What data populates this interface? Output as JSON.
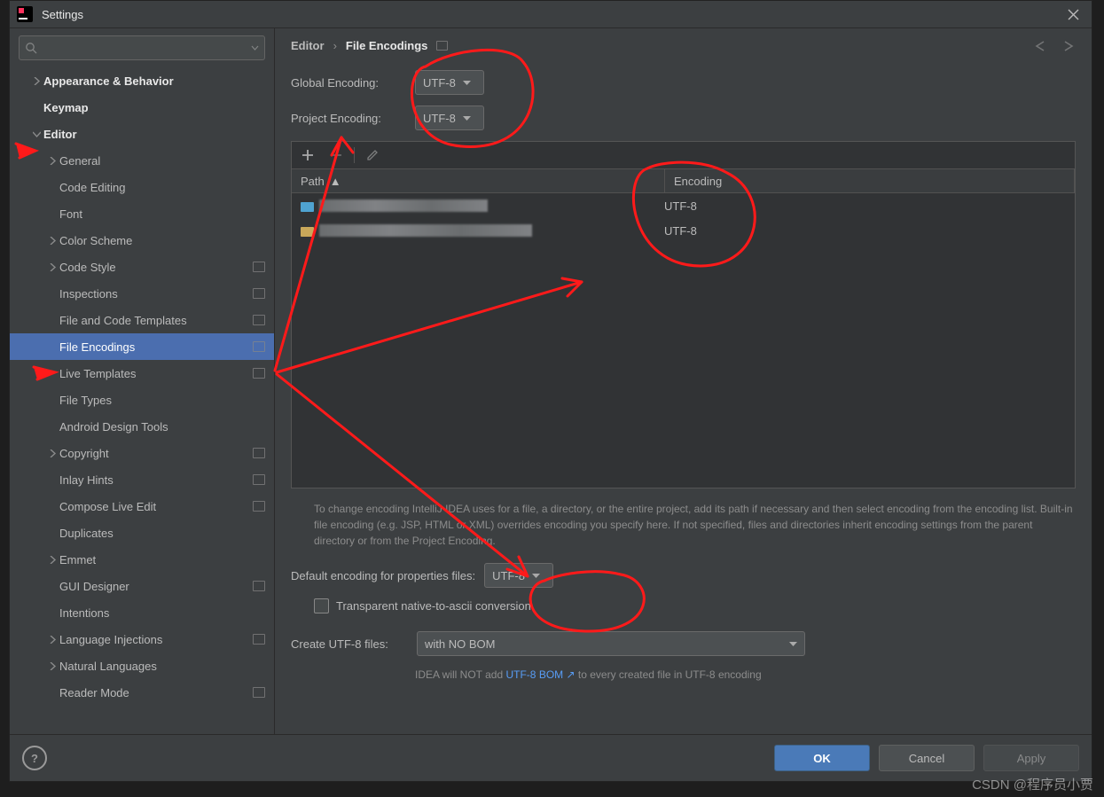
{
  "title": "Settings",
  "search_placeholder": "",
  "breadcrumb": {
    "root": "Editor",
    "current": "File Encodings"
  },
  "sidebarTitle": "Settings",
  "tree": [
    {
      "label": "Appearance & Behavior",
      "indent": 0,
      "chev": "right",
      "bold": true
    },
    {
      "label": "Keymap",
      "indent": 0,
      "bold": true
    },
    {
      "label": "Editor",
      "indent": 0,
      "chev": "down",
      "bold": true
    },
    {
      "label": "General",
      "indent": 1,
      "chev": "right"
    },
    {
      "label": "Code Editing",
      "indent": 1
    },
    {
      "label": "Font",
      "indent": 1
    },
    {
      "label": "Color Scheme",
      "indent": 1,
      "chev": "right"
    },
    {
      "label": "Code Style",
      "indent": 1,
      "chev": "right",
      "badge": true
    },
    {
      "label": "Inspections",
      "indent": 1,
      "badge": true
    },
    {
      "label": "File and Code Templates",
      "indent": 1,
      "badge": true
    },
    {
      "label": "File Encodings",
      "indent": 1,
      "badge": true,
      "selected": true
    },
    {
      "label": "Live Templates",
      "indent": 1,
      "badge": true
    },
    {
      "label": "File Types",
      "indent": 1
    },
    {
      "label": "Android Design Tools",
      "indent": 1
    },
    {
      "label": "Copyright",
      "indent": 1,
      "chev": "right",
      "badge": true
    },
    {
      "label": "Inlay Hints",
      "indent": 1,
      "badge": true
    },
    {
      "label": "Compose Live Edit",
      "indent": 1,
      "badge": true
    },
    {
      "label": "Duplicates",
      "indent": 1
    },
    {
      "label": "Emmet",
      "indent": 1,
      "chev": "right"
    },
    {
      "label": "GUI Designer",
      "indent": 1,
      "badge": true
    },
    {
      "label": "Intentions",
      "indent": 1
    },
    {
      "label": "Language Injections",
      "indent": 1,
      "chev": "right",
      "badge": true
    },
    {
      "label": "Natural Languages",
      "indent": 1,
      "chev": "right"
    },
    {
      "label": "Reader Mode",
      "indent": 1,
      "badge": true
    }
  ],
  "global_encoding_label": "Global Encoding:",
  "global_encoding_value": "UTF-8",
  "project_encoding_label": "Project Encoding:",
  "project_encoding_value": "UTF-8",
  "table": {
    "col1": "Path",
    "col2": "Encoding",
    "rows": [
      {
        "enc": "UTF-8",
        "icon": "folder"
      },
      {
        "enc": "UTF-8",
        "icon": "module"
      }
    ]
  },
  "help_text": "To change encoding IntelliJ IDEA uses for a file, a directory, or the entire project, add its path if necessary and then select encoding from the encoding list. Built-in file encoding (e.g. JSP, HTML or XML) overrides encoding you specify here. If not specified, files and directories inherit encoding settings from the parent directory or from the Project Encoding.",
  "default_props_label": "Default encoding for properties files:",
  "default_props_value": "UTF-8",
  "checkbox_label": "Transparent native-to-ascii conversion",
  "create_files_label": "Create UTF-8 files:",
  "create_files_value": "with NO BOM",
  "note_prefix": "IDEA will NOT add ",
  "note_link": "UTF-8 BOM",
  "note_suffix": " to every created file in UTF-8 encoding",
  "buttons": {
    "ok": "OK",
    "cancel": "Cancel",
    "apply": "Apply"
  },
  "watermark": "CSDN @程序员小贾"
}
